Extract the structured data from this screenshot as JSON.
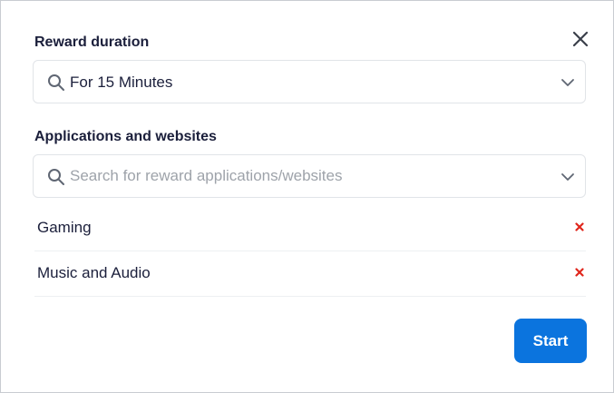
{
  "reward_duration": {
    "label": "Reward duration",
    "selected_value": "For 15 Minutes",
    "search_icon": "search-icon",
    "dropdown_icon": "chevron-down-icon"
  },
  "applications": {
    "label": "Applications and websites",
    "search_placeholder": "Search for reward applications/websites",
    "search_value": "",
    "items": [
      {
        "name": "Gaming",
        "remove_icon": "close-icon"
      },
      {
        "name": "Music and Audio",
        "remove_icon": "close-icon"
      }
    ]
  },
  "close_icon": "close-icon",
  "start_label": "Start",
  "colors": {
    "primary": "#0b74de",
    "remove": "#e0261c",
    "text": "#1b1f3b",
    "placeholder": "#9ea3aa",
    "border": "#e1e4e8"
  }
}
